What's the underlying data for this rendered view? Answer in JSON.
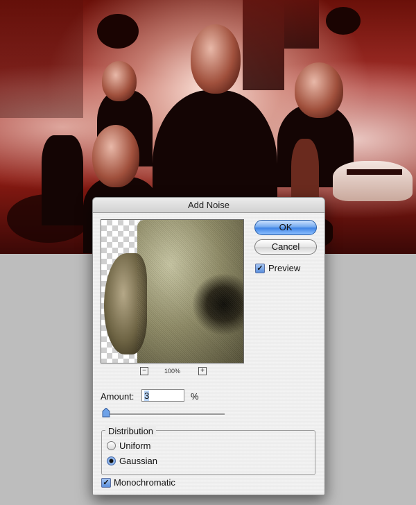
{
  "dialog": {
    "title": "Add Noise",
    "ok_label": "OK",
    "cancel_label": "Cancel",
    "preview_label": "Preview",
    "preview_checked": true,
    "zoom_value": "100%",
    "zoom_out_symbol": "−",
    "zoom_in_symbol": "+",
    "amount_label": "Amount:",
    "amount_value": "3",
    "amount_unit": "%",
    "amount_slider_fraction": 0.01,
    "distribution_label": "Distribution",
    "distribution_options": [
      {
        "label": "Uniform",
        "selected": false
      },
      {
        "label": "Gaussian",
        "selected": true
      }
    ],
    "monochromatic_label": "Monochromatic",
    "monochromatic_checked": true,
    "check_glyph": "✓"
  },
  "colors": {
    "accent": "#3d82e4",
    "dialog_bg": "#ececec",
    "desktop_bg": "#bdbdbd",
    "poster_red": "#8a1a12"
  }
}
